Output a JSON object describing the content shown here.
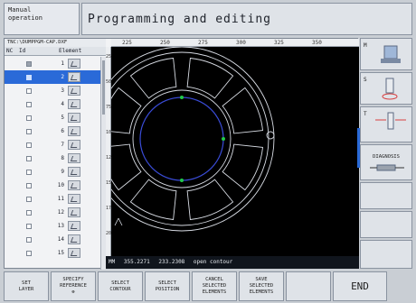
{
  "header": {
    "mode_line1": "Manual",
    "mode_line2": "operation",
    "title": "Programming and editing"
  },
  "file": {
    "path": "TNC:\\DUMPPGM-CAP.DXF",
    "columns": {
      "nc": "NC",
      "id": "Id",
      "element": "Element"
    }
  },
  "rows": [
    {
      "id": "1",
      "checked": true,
      "selected": false
    },
    {
      "id": "2",
      "checked": true,
      "selected": true
    },
    {
      "id": "3",
      "checked": false,
      "selected": false
    },
    {
      "id": "4",
      "checked": false,
      "selected": false
    },
    {
      "id": "5",
      "checked": false,
      "selected": false
    },
    {
      "id": "6",
      "checked": false,
      "selected": false
    },
    {
      "id": "7",
      "checked": false,
      "selected": false
    },
    {
      "id": "8",
      "checked": false,
      "selected": false
    },
    {
      "id": "9",
      "checked": false,
      "selected": false
    },
    {
      "id": "10",
      "checked": false,
      "selected": false
    },
    {
      "id": "11",
      "checked": false,
      "selected": false
    },
    {
      "id": "12",
      "checked": false,
      "selected": false
    },
    {
      "id": "13",
      "checked": false,
      "selected": false
    },
    {
      "id": "14",
      "checked": false,
      "selected": false
    },
    {
      "id": "15",
      "checked": false,
      "selected": false
    }
  ],
  "ruler": {
    "top": [
      "225",
      "250",
      "275",
      "300",
      "325",
      "350"
    ],
    "left": [
      "25",
      "50",
      "75",
      "100",
      "125",
      "150",
      "175",
      "200"
    ]
  },
  "status": {
    "label": "MM",
    "x": "355.2271",
    "y": "233.2308",
    "message": "open contour"
  },
  "right_keys": [
    {
      "letter": "M",
      "icon": "machine-icon"
    },
    {
      "letter": "S",
      "icon": "spindle-icon"
    },
    {
      "letter": "T",
      "icon": "tool-icon"
    },
    {
      "label": "DIAGNOSIS",
      "icon": "diagnosis-icon"
    }
  ],
  "softkeys": [
    {
      "line1": "SET",
      "line2": "LAYER",
      "line3": ""
    },
    {
      "line1": "SPECIFY",
      "line2": "REFERENCE",
      "line3": "⊕"
    },
    {
      "line1": "SELECT",
      "line2": "CONTOUR",
      "line3": ""
    },
    {
      "line1": "SELECT",
      "line2": "POSITION",
      "line3": ""
    },
    {
      "line1": "CANCEL",
      "line2": "SELECTED",
      "line3": "ELEMENTS"
    },
    {
      "line1": "SAVE",
      "line2": "SELECTED",
      "line3": "ELEMENTS"
    },
    {
      "line1": "",
      "line2": "",
      "line3": ""
    },
    {
      "label": "END"
    }
  ],
  "colors": {
    "selection": "#2a6ad8",
    "canvas": "#000000",
    "contour": "#d8dce4",
    "inner_circle": "#3a4cd8",
    "green_marker": "#22c84a"
  }
}
